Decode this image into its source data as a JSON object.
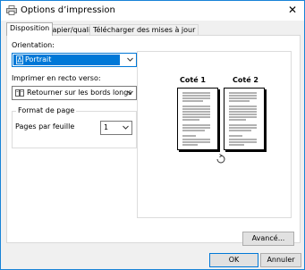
{
  "window": {
    "title": "Options d’impression"
  },
  "tabs": [
    {
      "label": "Disposition",
      "active": true
    },
    {
      "label": "Papier/qualité",
      "active": false
    },
    {
      "label": "Télécharger des mises à jour",
      "active": false
    }
  ],
  "orientation": {
    "label": "Orientation:",
    "value": "Portrait"
  },
  "duplex": {
    "label": "Imprimer en recto verso:",
    "value": "Retourner sur les bords longs"
  },
  "page_format": {
    "group_title": "Format de page",
    "pages_per_sheet_label": "Pages par feuille",
    "pages_per_sheet_value": "1"
  },
  "preview": {
    "side1": "Coté 1",
    "side2": "Coté 2"
  },
  "buttons": {
    "advanced": "Avancé...",
    "ok": "OK",
    "cancel": "Annuler"
  },
  "colors": {
    "accent": "#0078d7",
    "window_border": "#1883d7"
  }
}
